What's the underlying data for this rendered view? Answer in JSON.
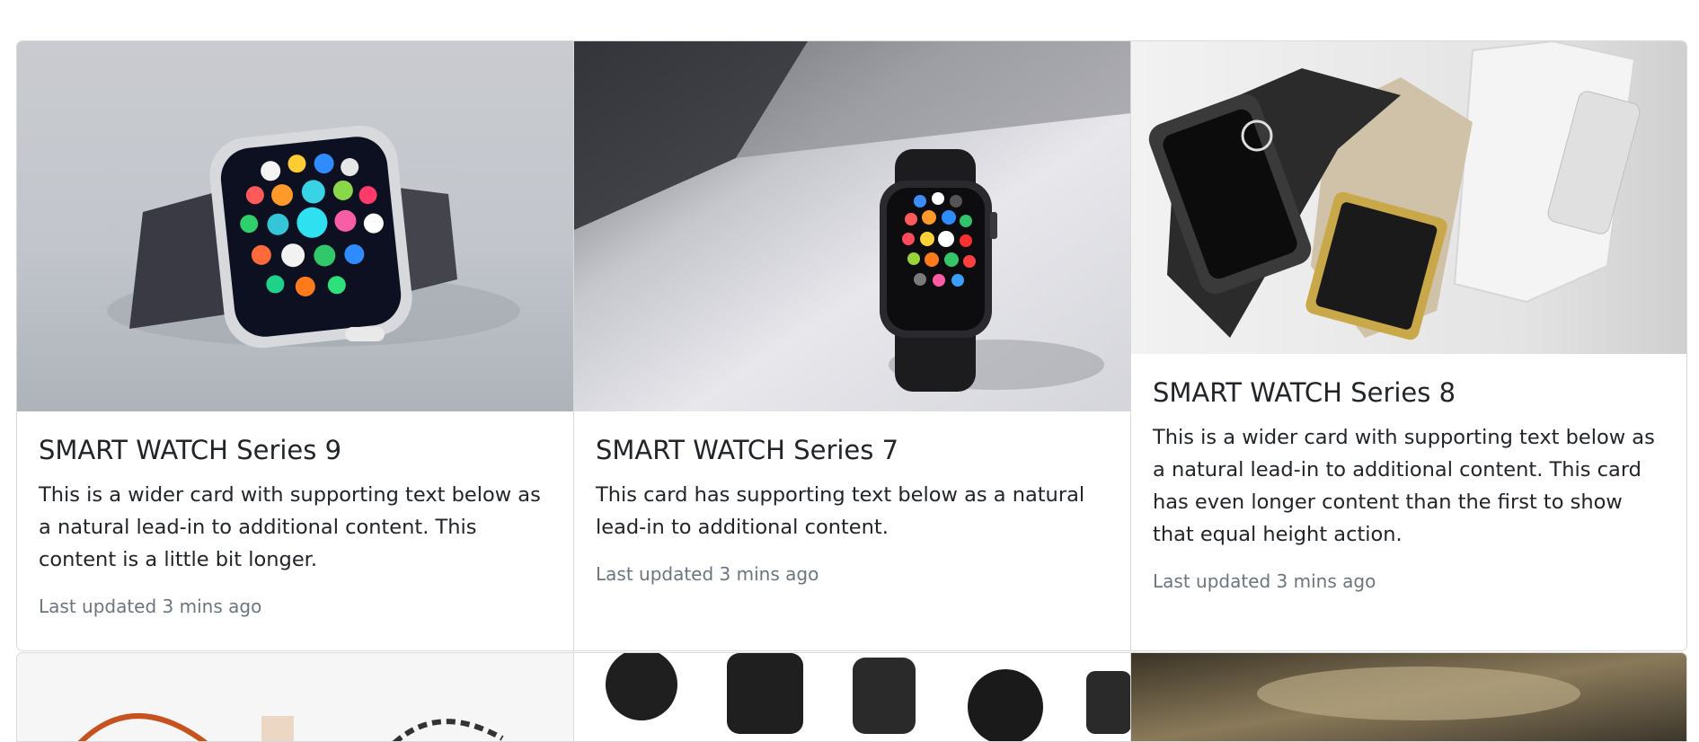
{
  "cards": [
    {
      "title": "SMART WATCH Series 9",
      "text": "This is a wider card with supporting text below as a natural lead-in to additional content. This content is a little bit longer.",
      "updated": "Last updated 3 mins ago",
      "image": "smartwatch-photo"
    },
    {
      "title": "SMART WATCH Series 7",
      "text": "This card has supporting text below as a natural lead-in to additional content.",
      "updated": "Last updated 3 mins ago",
      "image": "smartwatch-photo"
    },
    {
      "title": "SMART WATCH Series 8",
      "text": "This is a wider card with supporting text below as a natural lead-in to additional content. This card has even longer content than the first to show that equal height action.",
      "updated": "Last updated 3 mins ago",
      "image": "fitness-band-photo"
    }
  ],
  "colors": {
    "border": "#d9d9d9",
    "muted": "#6c757d",
    "title": "#212529"
  }
}
